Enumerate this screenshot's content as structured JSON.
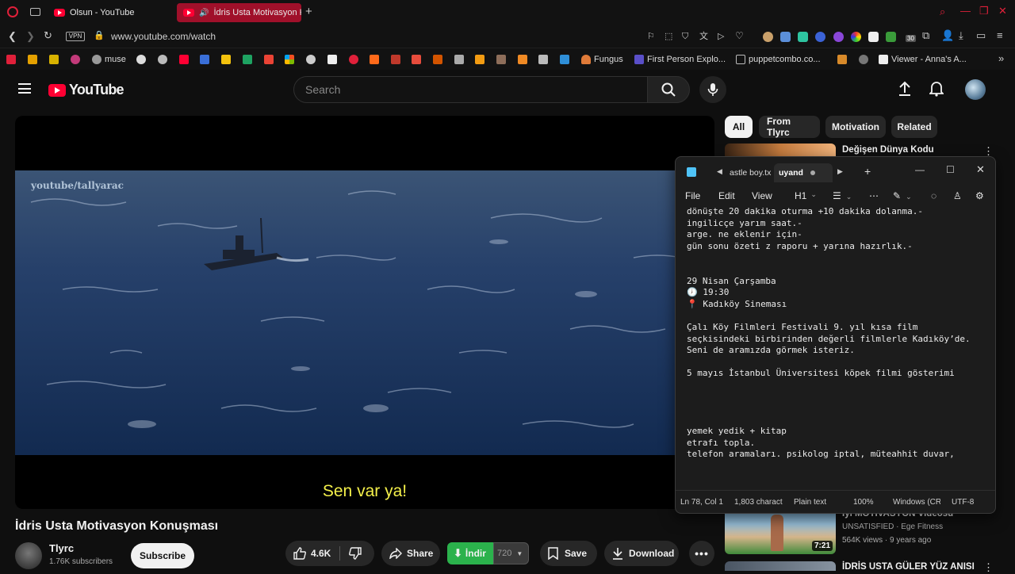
{
  "browser": {
    "tabs": [
      {
        "title": "Olsun - YouTube"
      },
      {
        "title": "İdris Usta Motivasyon K"
      }
    ],
    "url": "www.youtube.com/watch",
    "vpn_label": "VPN",
    "ext_badge": "30",
    "bookmarks": [
      {
        "label": "muse"
      },
      {
        "label": "Fungus"
      },
      {
        "label": "First Person Explo..."
      },
      {
        "label": "puppetcombo.co..."
      },
      {
        "label": "Viewer - Anna's A..."
      }
    ]
  },
  "youtube": {
    "logo_text": "YouTube",
    "search_placeholder": "Search",
    "chips": [
      "All",
      "From Tlyrc",
      "Motivation",
      "Related"
    ],
    "video": {
      "watermark": "youtube/tallyarac",
      "caption": "Sen var ya!",
      "title": "İdris Usta Motivasyon Konuşması"
    },
    "channel": {
      "name": "Tlyrc",
      "subscribers": "1.76K subscribers",
      "subscribe_label": "Subscribe"
    },
    "actions": {
      "likes": "4.6K",
      "share": "Share",
      "indir": "İndir",
      "indir_quality": "720",
      "save": "Save",
      "download": "Download"
    },
    "sidebar": [
      {
        "title": "Değişen Dünya Kodu"
      },
      {
        "title": "İyi MOTİVASYON Videosu",
        "channel": "UNSATISFIED · Ege Fitness",
        "meta": "564K views · 9 years ago",
        "duration": "7:21"
      },
      {
        "title": "İDRİS USTA GÜLER YÜZ ANISI"
      }
    ]
  },
  "notepad": {
    "tabs": [
      "astle boy.tx",
      "uyand"
    ],
    "menu": [
      "File",
      "Edit",
      "View"
    ],
    "heading_label": "H1",
    "lines": [
      "dönüşte 20 dakika oturma +10 dakika dolanma.-",
      "ingilicçe yarım saat.-",
      "arge. ne eklenir için-",
      "gün sonu özeti z raporu + yarına hazırlık.-",
      "",
      "",
      "29 Nisan Çarşamba",
      "🕖 19:30",
      "📍 Kadıköy Sineması",
      "",
      "Çalı Köy Filmleri Festivali 9. yıl kısa film",
      "seçkisindeki birbirinden değerli filmlerle Kadıköy’de.",
      "Seni de aramızda görmek isteriz.",
      "",
      "5 mayıs İstanbul Üniversitesi köpek filmi gösterimi",
      "",
      "",
      "",
      "",
      "yemek yedik + kitap",
      "etrafı topla.",
      "telefon aramaları. psikolog iptal, müteahhit duvar,"
    ],
    "status": {
      "position": "Ln 78, Col 1",
      "chars": "1,803 charact",
      "format": "Plain text",
      "zoom": "100%",
      "line_ending": "Windows (CR",
      "encoding": "UTF-8"
    }
  }
}
